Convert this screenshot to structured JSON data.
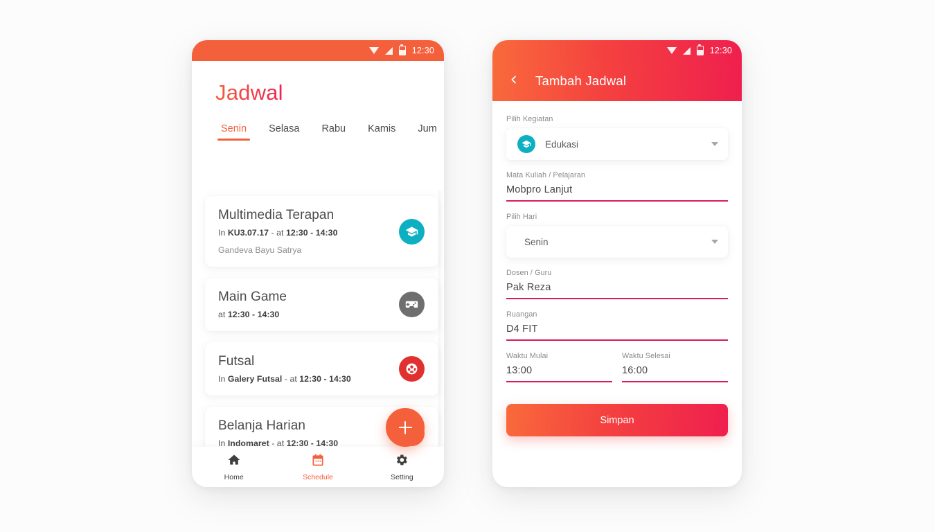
{
  "statusbar": {
    "time": "12:30"
  },
  "left_phone": {
    "page_title": "Jadwal",
    "tabs": [
      {
        "label": "Senin",
        "active": true
      },
      {
        "label": "Selasa",
        "active": false
      },
      {
        "label": "Rabu",
        "active": false
      },
      {
        "label": "Kamis",
        "active": false
      },
      {
        "label": "Jum",
        "active": false
      }
    ],
    "cards": [
      {
        "title": "Multimedia Terapan",
        "meta_prefix": "In ",
        "meta_place": "KU3.07.17",
        "meta_mid": " - at ",
        "meta_time": "12:30 - 14:30",
        "sub": "Gandeva Bayu Satrya",
        "icon": "graduation-cap-icon",
        "icon_color": "#0cb0c0"
      },
      {
        "title": "Main Game",
        "meta_prefix": "",
        "meta_place": "",
        "meta_mid": "at ",
        "meta_time": "12:30 - 14:30",
        "sub": "",
        "icon": "gamepad-icon",
        "icon_color": "#6e6e6e"
      },
      {
        "title": "Futsal",
        "meta_prefix": "In ",
        "meta_place": "Galery Futsal",
        "meta_mid": " - at ",
        "meta_time": "12:30 - 14:30",
        "sub": "",
        "icon": "soccer-ball-icon",
        "icon_color": "#e0302f"
      },
      {
        "title": "Belanja Harian",
        "meta_prefix": "In ",
        "meta_place": "Indomaret",
        "meta_mid": " - at ",
        "meta_time": "12:30 - 14:30",
        "sub": "",
        "icon": "cart-icon",
        "icon_color": "#f4603c"
      }
    ],
    "fab": {
      "icon": "plus-icon",
      "color": "#f4603c"
    },
    "bottom_nav": [
      {
        "label": "Home",
        "icon": "home-icon",
        "active": false
      },
      {
        "label": "Schedule",
        "icon": "calendar-icon",
        "active": true
      },
      {
        "label": "Setting",
        "icon": "gear-icon",
        "active": false
      }
    ]
  },
  "right_phone": {
    "appbar": {
      "title": "Tambah Jadwal",
      "back_icon": "chevron-left-icon"
    },
    "fields": {
      "kegiatan": {
        "label": "Pilih Kegiatan",
        "value": "Edukasi",
        "icon": "graduation-cap-icon",
        "icon_color": "#0cb0c0"
      },
      "matkul": {
        "label": "Mata Kuliah / Pelajaran",
        "value": "Mobpro Lanjut"
      },
      "hari": {
        "label": "Pilih Hari",
        "value": "Senin"
      },
      "dosen": {
        "label": "Dosen / Guru",
        "value": "Pak Reza"
      },
      "ruangan": {
        "label": "Ruangan",
        "value": "D4 FIT"
      },
      "mulai": {
        "label": "Waktu Mulai",
        "value": "13:00"
      },
      "selesai": {
        "label": "Waktu Selesai",
        "value": "16:00"
      }
    },
    "save_button": "Simpan"
  },
  "colors": {
    "accent_orange": "#f4603c",
    "accent_crimson": "#ef1f4e",
    "underline": "#d81b60",
    "teal": "#0cb0c0"
  }
}
